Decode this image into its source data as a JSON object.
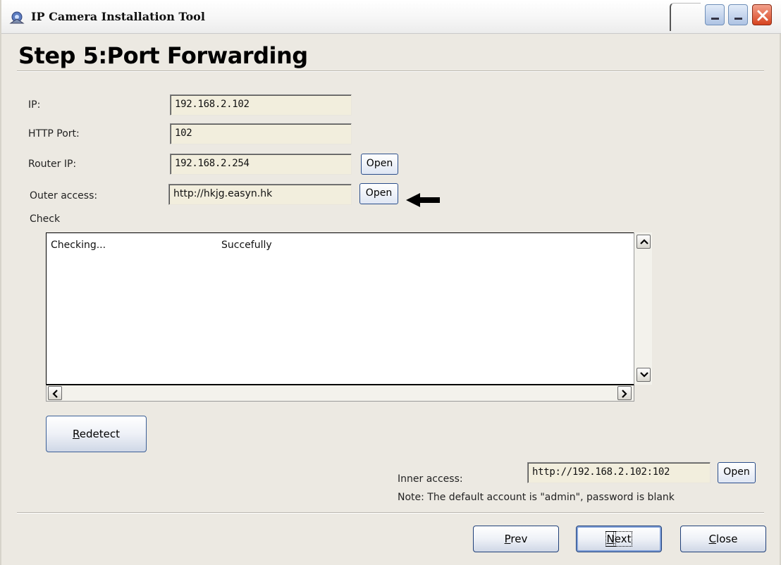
{
  "window": {
    "title": "IP Camera Installation Tool"
  },
  "page": {
    "heading": "Step 5:Port Forwarding"
  },
  "form": {
    "ip": {
      "label": "IP:",
      "value": "192.168.2.102"
    },
    "http_port": {
      "label": "HTTP Port:",
      "value": "102"
    },
    "router_ip": {
      "label": "Router IP:",
      "value": "192.168.2.254",
      "button": "Open"
    },
    "outer_access": {
      "label": "Outer access:",
      "value": "http://hkjg.easyn.hk",
      "button": "Open"
    }
  },
  "check": {
    "label": "Check",
    "rows": [
      {
        "col1": "Checking...",
        "col2": "Succefully"
      }
    ]
  },
  "redetect": {
    "first_letter": "R",
    "rest": "edetect"
  },
  "inner": {
    "label": "Inner access:",
    "value": "http://192.168.2.102:102",
    "button": "Open",
    "note": "Note: The default account is \"admin\", password is blank"
  },
  "nav": {
    "prev": {
      "first_letter": "P",
      "rest": "rev"
    },
    "next": {
      "first_letter": "N",
      "rest": "ext"
    },
    "close": {
      "first_letter": "C",
      "rest": "lose"
    }
  }
}
